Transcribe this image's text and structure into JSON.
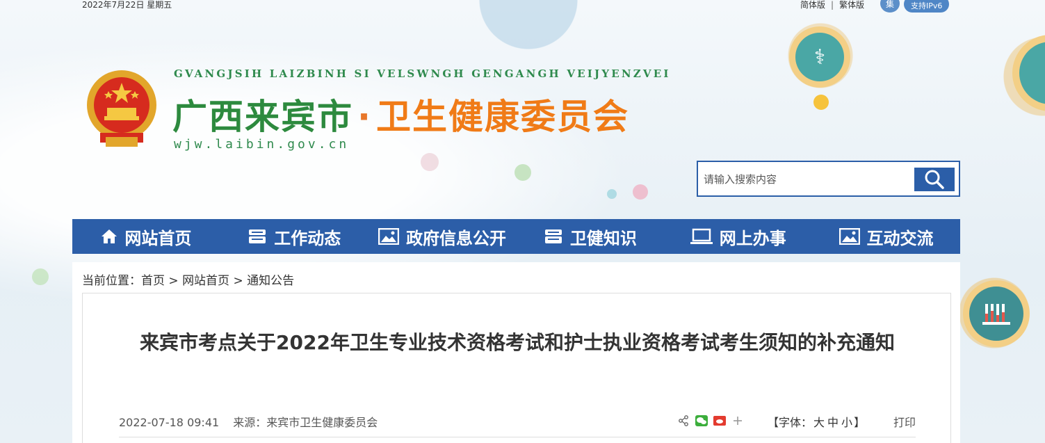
{
  "topbar": {
    "date": "2022年7月22日  星期五",
    "simplified": "简体版",
    "separator": "|",
    "traditional": "繁体版",
    "ipv6_label": "支持IPv6",
    "ipv6_globe_text": "集"
  },
  "header": {
    "pinyin": "GVANGJSIH  LAIZBINH SI VELSWNGH GENGANGH VEIJYENZVEI",
    "city": "广西来宾市",
    "dot": "·",
    "org": "卫生健康委员会",
    "domain": "wjw.laibin.gov.cn"
  },
  "search": {
    "placeholder": "请输入搜索内容"
  },
  "nav": [
    {
      "label": "网站首页",
      "icon": "home-icon"
    },
    {
      "label": "工作动态",
      "icon": "news-icon"
    },
    {
      "label": "政府信息公开",
      "icon": "image-icon"
    },
    {
      "label": "卫健知识",
      "icon": "news-icon"
    },
    {
      "label": "网上办事",
      "icon": "laptop-icon"
    },
    {
      "label": "互动交流",
      "icon": "image-icon"
    }
  ],
  "breadcrumb": {
    "prefix": "当前位置：",
    "home": "首页",
    "sep": " > ",
    "section": "网站首页",
    "current": "通知公告"
  },
  "article": {
    "title": "来宾市考点关于2022年卫生专业技术资格考试和护士执业资格考试考生须知的补充通知",
    "datetime": "2022-07-18 09:41",
    "source": "来源：来宾市卫生健康委员会",
    "font_label_open": "【字体：",
    "font_large": "大",
    "font_medium": "中",
    "font_small": "小",
    "font_label_close": "】",
    "print": "打印"
  },
  "colors": {
    "nav_bg": "#2c5ea8",
    "green": "#2d8a3e",
    "orange": "#f07b17"
  }
}
